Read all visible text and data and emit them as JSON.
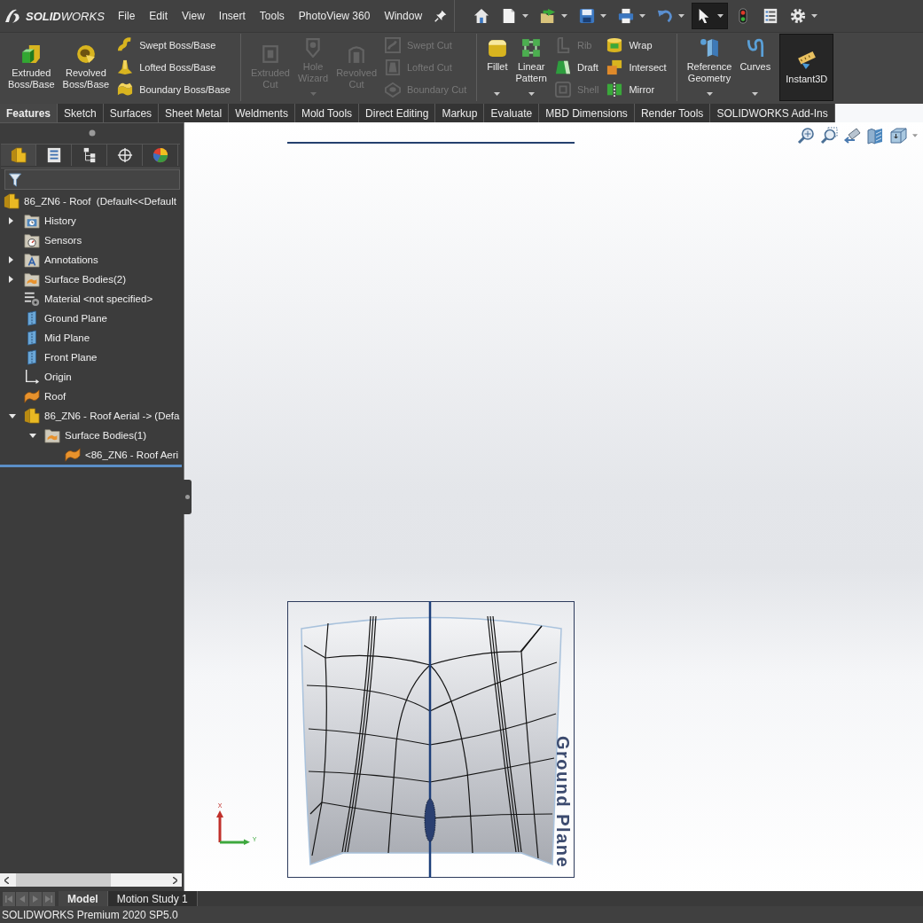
{
  "app": {
    "logo": "**SOLID**WORKS"
  },
  "menu": [
    "File",
    "Edit",
    "View",
    "Insert",
    "Tools",
    "PhotoView 360",
    "Window"
  ],
  "quick_access": [
    {
      "kind": "home",
      "dropdown": false,
      "selected": false
    },
    {
      "kind": "new",
      "dropdown": true,
      "selected": false
    },
    {
      "kind": "open",
      "dropdown": true,
      "selected": false
    },
    {
      "kind": "save",
      "dropdown": true,
      "selected": false
    },
    {
      "kind": "print",
      "dropdown": true,
      "selected": false
    },
    {
      "kind": "undo",
      "dropdown": true,
      "selected": false
    },
    {
      "kind": "select",
      "dropdown": true,
      "selected": true
    },
    {
      "kind": "rebuild",
      "dropdown": false,
      "selected": false
    },
    {
      "kind": "properties",
      "dropdown": false,
      "selected": false
    },
    {
      "kind": "options",
      "dropdown": true,
      "selected": false
    }
  ],
  "ribbon": [
    {
      "columns": [
        {
          "kind": "large",
          "tools": [
            {
              "label": "Extruded Boss/Base",
              "disabled": false,
              "on": false,
              "dropdown": false
            }
          ]
        },
        {
          "kind": "large",
          "tools": [
            {
              "label": "Revolved Boss/Base",
              "disabled": false,
              "on": false,
              "dropdown": false
            }
          ]
        },
        {
          "kind": "stack",
          "tools": [
            {
              "label": "Swept Boss/Base",
              "disabled": false,
              "on": false,
              "dropdown": false
            },
            {
              "label": "Lofted Boss/Base",
              "disabled": false,
              "on": false,
              "dropdown": false
            },
            {
              "label": "Boundary Boss/Base",
              "disabled": false,
              "on": false,
              "dropdown": false
            }
          ]
        }
      ]
    },
    {
      "columns": [
        {
          "kind": "large",
          "tools": [
            {
              "label": "Extruded Cut",
              "disabled": true,
              "on": false,
              "dropdown": false
            }
          ]
        },
        {
          "kind": "large",
          "tools": [
            {
              "label": "Hole Wizard",
              "disabled": true,
              "on": false,
              "dropdown": true
            }
          ]
        },
        {
          "kind": "large",
          "tools": [
            {
              "label": "Revolved Cut",
              "disabled": true,
              "on": false,
              "dropdown": false
            }
          ]
        },
        {
          "kind": "stack",
          "tools": [
            {
              "label": "Swept Cut",
              "disabled": true,
              "on": false,
              "dropdown": false
            },
            {
              "label": "Lofted Cut",
              "disabled": true,
              "on": false,
              "dropdown": false
            },
            {
              "label": "Boundary Cut",
              "disabled": true,
              "on": false,
              "dropdown": false
            }
          ]
        }
      ]
    },
    {
      "columns": [
        {
          "kind": "large",
          "tools": [
            {
              "label": "Fillet",
              "disabled": false,
              "on": false,
              "dropdown": true
            }
          ]
        },
        {
          "kind": "large",
          "tools": [
            {
              "label": "Linear Pattern",
              "disabled": false,
              "on": false,
              "dropdown": true
            }
          ]
        },
        {
          "kind": "stack",
          "tools": [
            {
              "label": "Rib",
              "disabled": true,
              "on": false,
              "dropdown": false
            },
            {
              "label": "Draft",
              "disabled": false,
              "on": false,
              "dropdown": false
            },
            {
              "label": "Shell",
              "disabled": true,
              "on": false,
              "dropdown": false
            }
          ]
        },
        {
          "kind": "stack",
          "tools": [
            {
              "label": "Wrap",
              "disabled": false,
              "on": false,
              "dropdown": false
            },
            {
              "label": "Intersect",
              "disabled": false,
              "on": false,
              "dropdown": false
            },
            {
              "label": "Mirror",
              "disabled": false,
              "on": false,
              "dropdown": false
            }
          ]
        }
      ]
    },
    {
      "columns": [
        {
          "kind": "large",
          "tools": [
            {
              "label": "Reference Geometry",
              "disabled": false,
              "on": false,
              "dropdown": true
            }
          ]
        },
        {
          "kind": "large",
          "tools": [
            {
              "label": "Curves",
              "disabled": false,
              "on": false,
              "dropdown": true
            }
          ]
        },
        {
          "kind": "large",
          "tools": [
            {
              "label": "Instant3D",
              "disabled": false,
              "on": true,
              "dropdown": false
            }
          ]
        }
      ]
    }
  ],
  "command_tabs": [
    {
      "label": "Features",
      "selected": true
    },
    {
      "label": "Sketch",
      "selected": false
    },
    {
      "label": "Surfaces",
      "selected": false
    },
    {
      "label": "Sheet Metal",
      "selected": false
    },
    {
      "label": "Weldments",
      "selected": false
    },
    {
      "label": "Mold Tools",
      "selected": false
    },
    {
      "label": "Direct Editing",
      "selected": false
    },
    {
      "label": "Markup",
      "selected": false
    },
    {
      "label": "Evaluate",
      "selected": false
    },
    {
      "label": "MBD Dimensions",
      "selected": false
    },
    {
      "label": "Render Tools",
      "selected": false
    },
    {
      "label": "SOLIDWORKS Add-Ins",
      "selected": false
    }
  ],
  "feature_manager": {
    "tabs": [
      {
        "selected": true
      },
      {
        "selected": false
      },
      {
        "selected": false
      },
      {
        "selected": false
      },
      {
        "selected": false
      }
    ],
    "tree": [
      {
        "label": "86_ZN6 - Roof  (Default<<Default",
        "kind": "part",
        "children": [
          {
            "label": "History",
            "kind": "history",
            "expanded": false
          },
          {
            "label": "Sensors",
            "kind": "sensors"
          },
          {
            "label": "Annotations",
            "kind": "annotations",
            "expanded": false
          },
          {
            "label": "Surface Bodies(2)",
            "kind": "bodies",
            "expanded": false
          },
          {
            "label": "Material <not specified>",
            "kind": "material"
          },
          {
            "label": "Ground Plane",
            "kind": "plane"
          },
          {
            "label": "Mid Plane",
            "kind": "plane"
          },
          {
            "label": "Front Plane",
            "kind": "plane"
          },
          {
            "label": "Origin",
            "kind": "origin"
          },
          {
            "label": "Roof",
            "kind": "surface"
          },
          {
            "label": "86_ZN6 - Roof Aerial -> (Defa",
            "kind": "part",
            "expanded": true,
            "children": [
              {
                "label": "Surface Bodies(1)",
                "kind": "bodies",
                "expanded": true,
                "children": [
                  {
                    "label": "<86_ZN6 - Roof Aeri",
                    "kind": "surface"
                  }
                ]
              }
            ]
          }
        ]
      }
    ]
  },
  "viewport": {
    "plane_label": "Ground Plane",
    "triad": {
      "x_label": "X",
      "y_label": "Y"
    }
  },
  "bottom_tabs": {
    "nav": [
      {
        "disabled": true
      },
      {
        "disabled": true
      },
      {
        "disabled": true
      },
      {
        "disabled": true
      }
    ],
    "tabs": [
      {
        "label": "Model",
        "selected": true
      },
      {
        "label": "Motion Study 1",
        "selected": false
      }
    ]
  },
  "status_bar": {
    "text": "SOLIDWORKS Premium 2020 SP5.0"
  }
}
